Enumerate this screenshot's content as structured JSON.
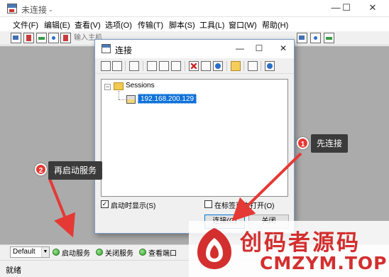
{
  "window": {
    "title": "未连接 -",
    "minimize": "—",
    "maximize": "☐",
    "close": "✕"
  },
  "menu": [
    "文件(F)",
    "编辑(E)",
    "查看(V)",
    "选项(O)",
    "传输(T)",
    "脚本(S)",
    "工具(L)",
    "窗口(W)",
    "帮助(H)"
  ],
  "toolbar": {
    "host_placeholder": "输入主机 <Alt+R>"
  },
  "dialog": {
    "title": "连接",
    "tree_root": "Sessions",
    "tree_expander": "−",
    "session_host": "192.168.200.129",
    "show_on_startup_label": "启动时显示(S)",
    "show_on_startup_checked": true,
    "open_in_tab_label": "在标签页中打开(O)",
    "open_in_tab_checked": false,
    "connect_button": "连接(C)",
    "close_button": "关闭"
  },
  "session_bar": {
    "selected_session": "Default",
    "buttons": [
      "启动服务",
      "关闭服务",
      "查看端口"
    ]
  },
  "status": "就绪",
  "annotations": [
    {
      "number": "1",
      "text": "先连接"
    },
    {
      "number": "2",
      "text": "再启动服务"
    }
  ],
  "watermark": {
    "line1": "创码者源码",
    "line2": "CMZYM.TOP"
  },
  "colors": {
    "accent_red": "#e53935",
    "selection_blue": "#0f72d8",
    "service_green": "#2e9e2a"
  }
}
